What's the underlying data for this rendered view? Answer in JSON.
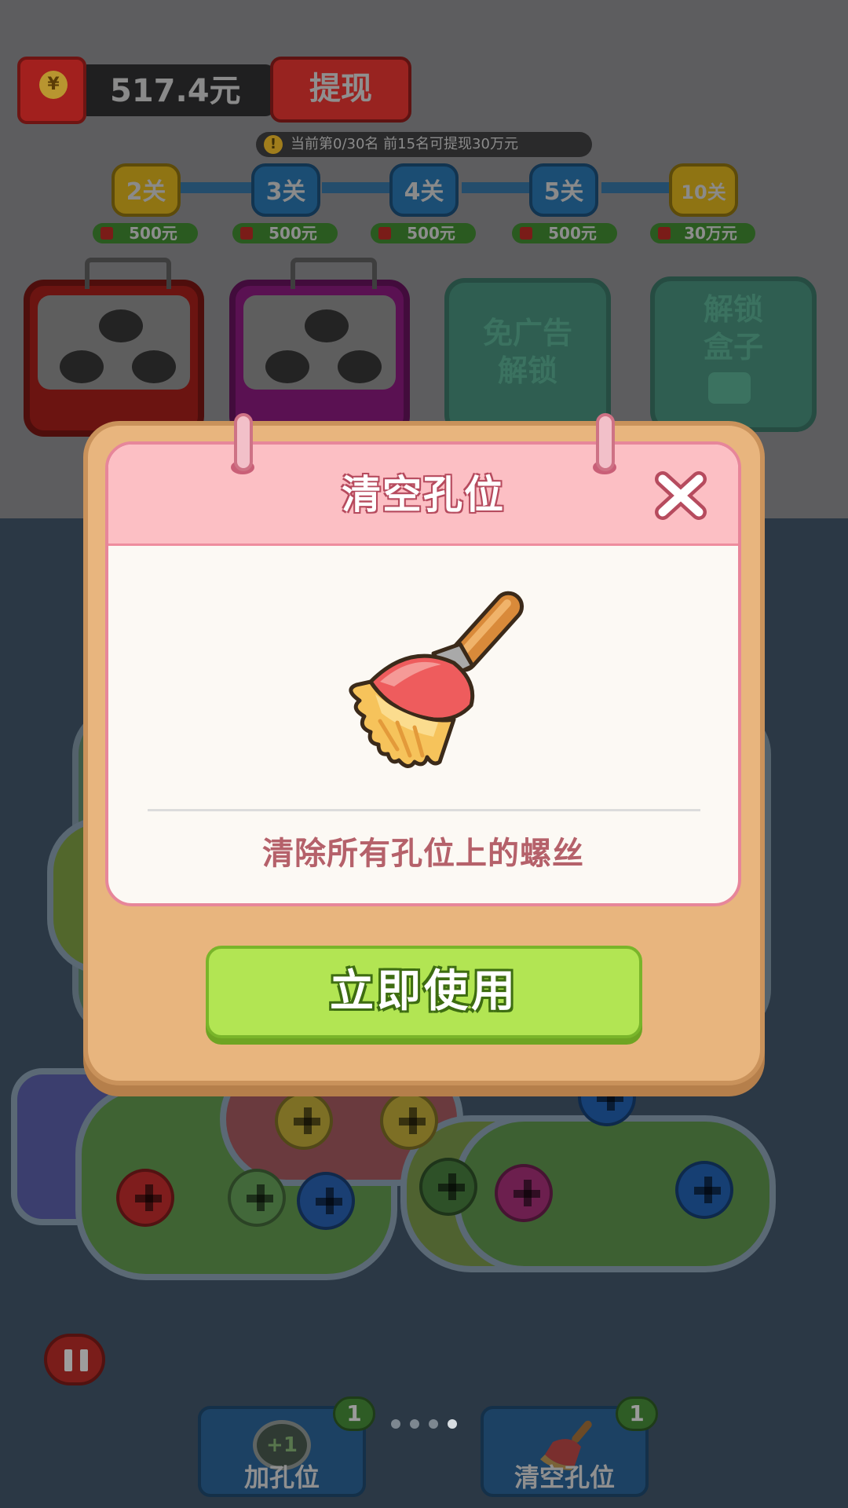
{
  "wallet": {
    "amount": "517.4元",
    "withdraw_label": "提现",
    "currency_symbol": "¥"
  },
  "rank_notice": "当前第0/30名  前15名可提现30万元",
  "levels": [
    {
      "label": "2关",
      "reward": "500元"
    },
    {
      "label": "3关",
      "reward": "500元"
    },
    {
      "label": "4关",
      "reward": "500元"
    },
    {
      "label": "5关",
      "reward": "500元"
    },
    {
      "label": "10关",
      "reward": "30万元"
    }
  ],
  "boxes": {
    "box3_label_line1": "免广告",
    "box3_label_line2": "解锁",
    "box4_label_line1": "解锁",
    "box4_label_line2": "盒子"
  },
  "dialog": {
    "title": "清空孔位",
    "description": "清除所有孔位上的螺丝",
    "button": "立即使用"
  },
  "tools": [
    {
      "label": "加孔位",
      "count": "1",
      "icon_text": "+1"
    },
    {
      "label": "清空孔位",
      "count": "1"
    }
  ],
  "page_indicator": {
    "total": 4,
    "active": 4
  },
  "colors": {
    "dialog_bg": "#e8b57e",
    "header_pink": "#fcbfc4",
    "button_green": "#b2e553",
    "description_text": "#b5616a"
  }
}
